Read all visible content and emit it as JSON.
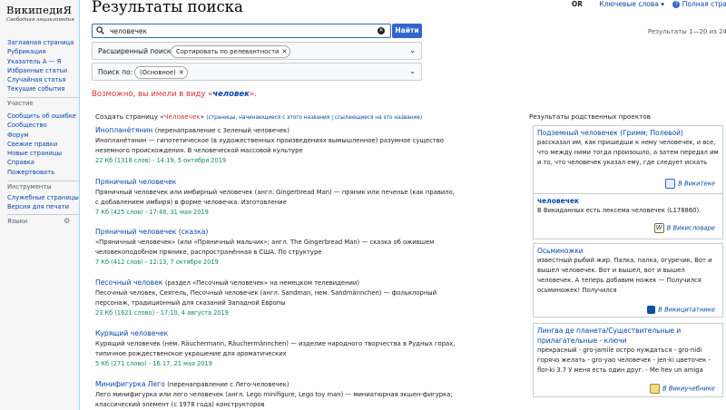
{
  "logo": {
    "title": "ВикипедиЯ",
    "subtitle": "Свободная энциклопедия"
  },
  "nav": {
    "main": [
      "Заглавная страница",
      "Рубрикация",
      "Указатель А — Я",
      "Избранные статьи",
      "Случайная статья",
      "Текущие события"
    ],
    "participation_heading": "Участие",
    "participation": [
      "Сообщить об ошибке",
      "Сообщество",
      "Форум",
      "Свежие правки",
      "Новые страницы",
      "Справка",
      "Пожертвовать"
    ],
    "tools_heading": "Инструменты",
    "tools": [
      "Служебные страницы",
      "Версия для печати"
    ],
    "languages_heading": "Языки"
  },
  "topbar": {
    "or": "OR",
    "keywords": "Ключевые слова",
    "full": "Полная стра"
  },
  "page_title": "Результаты поиска",
  "search": {
    "value": "человечек",
    "button": "Найти"
  },
  "results_count": "Результаты 1—20 из 24",
  "filters": {
    "advanced_label": "Расширенный поиск:",
    "advanced_chip": "Сортировать по релевантности",
    "ns_label": "Поиск по:",
    "ns_chip": "(Основное)"
  },
  "did_you_mean": {
    "prefix": "Возможно, вы имели в виду «",
    "word": "человек",
    "suffix": "»."
  },
  "create": {
    "prefix": "Создать страницу «",
    "word": "Человечек",
    "suffix": "»",
    "links": "(страницы, начинающиеся с этого названия | ссылающиеся на это название)"
  },
  "results": [
    {
      "title": "Иноплане́тянин",
      "alt": "(перенаправление с Зеленый человечек)",
      "snippet": "Иноплане́тянин — гипотетическое (в художественных произведениях вымышленное) разумное существо неземного происхождения. В человеческой массовой культуре",
      "meta": "22 Кб (1318 слов) - 14:19, 5 октября 2019"
    },
    {
      "title": "Пряничный человечек",
      "alt": "",
      "snippet": "Пряничный человечек или имбирный человечек (англ. Gingerbread Man) — пряник или печенье (как правило, с добавлением имбиря) в форме человечка. Изготовление",
      "meta": "7 Кб (425 слов) - 17:48, 31 мая 2019"
    },
    {
      "title": "Пряничный человечек (сказка)",
      "alt": "",
      "snippet": "«Пряничный человечек» (или «Пряничный мальчик»; англ. The Gingerbread Man) — сказка об ожившем человекоподобном прянике, распространённая в США. По структуре",
      "meta": "7 Кб (412 слов) - 12:13, 7 октября 2019"
    },
    {
      "title": "Песочный человек",
      "alt": "(раздел «Песочный человечек» на немецком телевидении)",
      "snippet": "Песочный человек, Сеятель, Песочный человечек (англ. Sandman, нем. Sandmännchen) — фольклорный персонаж, традиционный для сказаний Западной Европы",
      "meta": "23 Кб (1621 слово) - 17:10, 4 августа 2019"
    },
    {
      "title": "Курящий человечек",
      "alt": "",
      "snippet": "Курящий человечек (нем. Räuchermann, Räuchermännchen) — изделие народного творчества в Рудных горах, типичное рождественское украшение для ароматических",
      "meta": "5 Кб (271 слово) - 16:17, 21 мая 2019"
    },
    {
      "title": "Минифигурка Лего",
      "alt": "(перенаправление с Лего-человечек)",
      "snippet": "Лего минифигурка или лего человечек (англ. Lego minifigure, Lego toy man) — миниатюрная экшен-фигурка; классический элемент (с 1978 года) конструкторов",
      "meta": ""
    }
  ],
  "projects_heading": "Результаты родственных проектов",
  "projects": [
    {
      "title": "Подземный человечек (Гримм; Полевой)",
      "text": "рассказал им, как пришедши к нему человечек, и все, что между ними тогда произошло, а затем передал им и то, что человечек указал ему, где следует искать",
      "source": "В Викитеке",
      "icon_color": "#3366cc",
      "icon": "wikisource-icon"
    },
    {
      "title": "человечек",
      "text": "В Викиданных есть лексема человечек (L178860).",
      "source": "В Викисловаре",
      "icon_color": "#7a6a44",
      "icon": "wiktionary-icon"
    },
    {
      "title": "Осьминожки",
      "text": "известный рыбий жир. Палка, палка, огуречик, Вот и вышел человечек. Вот и вышел, вот и вышел человечек. А теперь добавим ножек — Получился осьминожек! Получился",
      "source": "В Викицитатнике",
      "icon_color": "#0b4f9e",
      "icon": "wikiquote-icon"
    },
    {
      "title": "Лингва де планета/Существительные и прилагательные - ключи",
      "text": "прекрасный - grо-jamile острo нуждаться - grо-nidi горячо желать - grо-yao человечек - jen-ki цветочек - flor-ki 3.7 У меня есть один друг. - Me hev un amiga",
      "source": "В Викиучебнике",
      "icon_color": "#b4841a",
      "icon": "wikibooks-icon"
    }
  ]
}
